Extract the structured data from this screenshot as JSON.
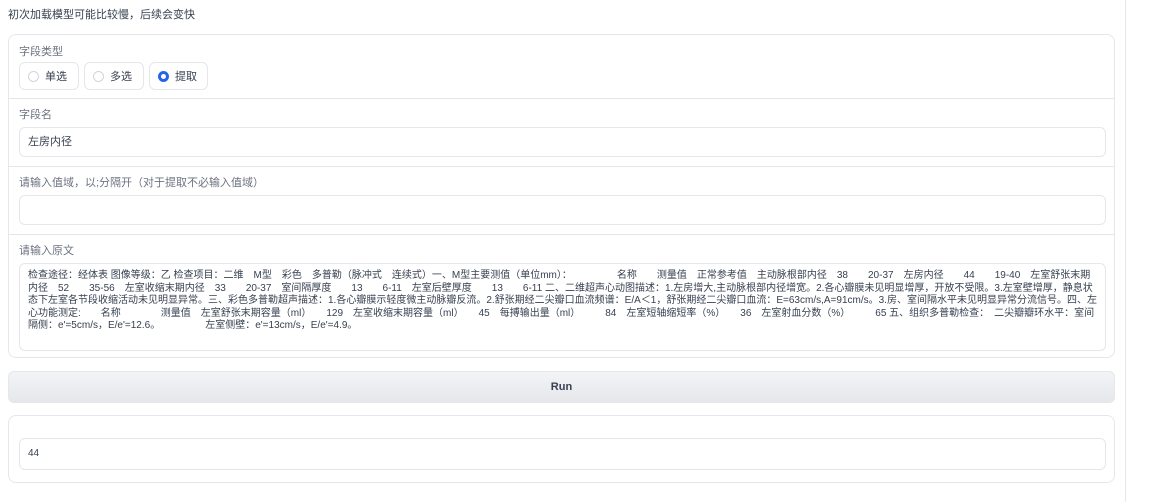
{
  "notice": "初次加载模型可能比较慢，后续会变快",
  "field_type": {
    "label": "字段类型",
    "options": [
      {
        "label": "单选",
        "selected": false
      },
      {
        "label": "多选",
        "selected": false
      },
      {
        "label": "提取",
        "selected": true
      }
    ]
  },
  "field_name": {
    "label": "字段名",
    "value": "左房内径"
  },
  "value_domain": {
    "label": "请输入值域，以;分隔开（对于提取不必输入值域）",
    "value": ""
  },
  "source_text": {
    "label": "请输入原文",
    "value": "检查途径：经体表 图像等级：乙 检查项目：二维　M型　彩色　多普勒（脉冲式　连续式）一、M型主要测值（单位mm）：　　　　　名称　　测量值　正常参考值　主动脉根部内径　38　　20-37　左房内径　　44　　19-40　左室舒张末期内径　52　　35-56　左室收缩末期内径　33　　20-37　室间隔厚度　　13　　6-11　左室后壁厚度　　13　　6-11 二、二维超声心动图描述：1.左房增大,主动脉根部内径增宽。2.各心瓣膜未见明显增厚，开放不受限。3.左室壁增厚，静息状态下左室各节段收缩活动未见明显异常。三、彩色多普勒超声描述：1.各心瓣膜示轻度微主动脉瓣反流。2.舒张期经二尖瓣口血流频谱：E/A＜1，舒张期经二尖瓣口血流：E=63cm/s,A=91cm/s。3.房、室间隔水平未见明显异常分流信号。四、左心功能测定:　　名称　　　　测量值　左室舒张末期容量（ml）　　129　左室收缩末期容量（ml）　　45　每搏输出量（ml）　　　84　左室短轴缩短率（%）　　36　左室射血分数（%）　　　65 五、组织多普勒检查：　二尖瓣瓣环水平：室间隔侧：e'=5cm/s，E/e'=12.6。　　　　　左室侧壁：e'=13cm/s，E/e'=4.9。"
  },
  "run_label": "Run",
  "output": {
    "value": "44"
  }
}
